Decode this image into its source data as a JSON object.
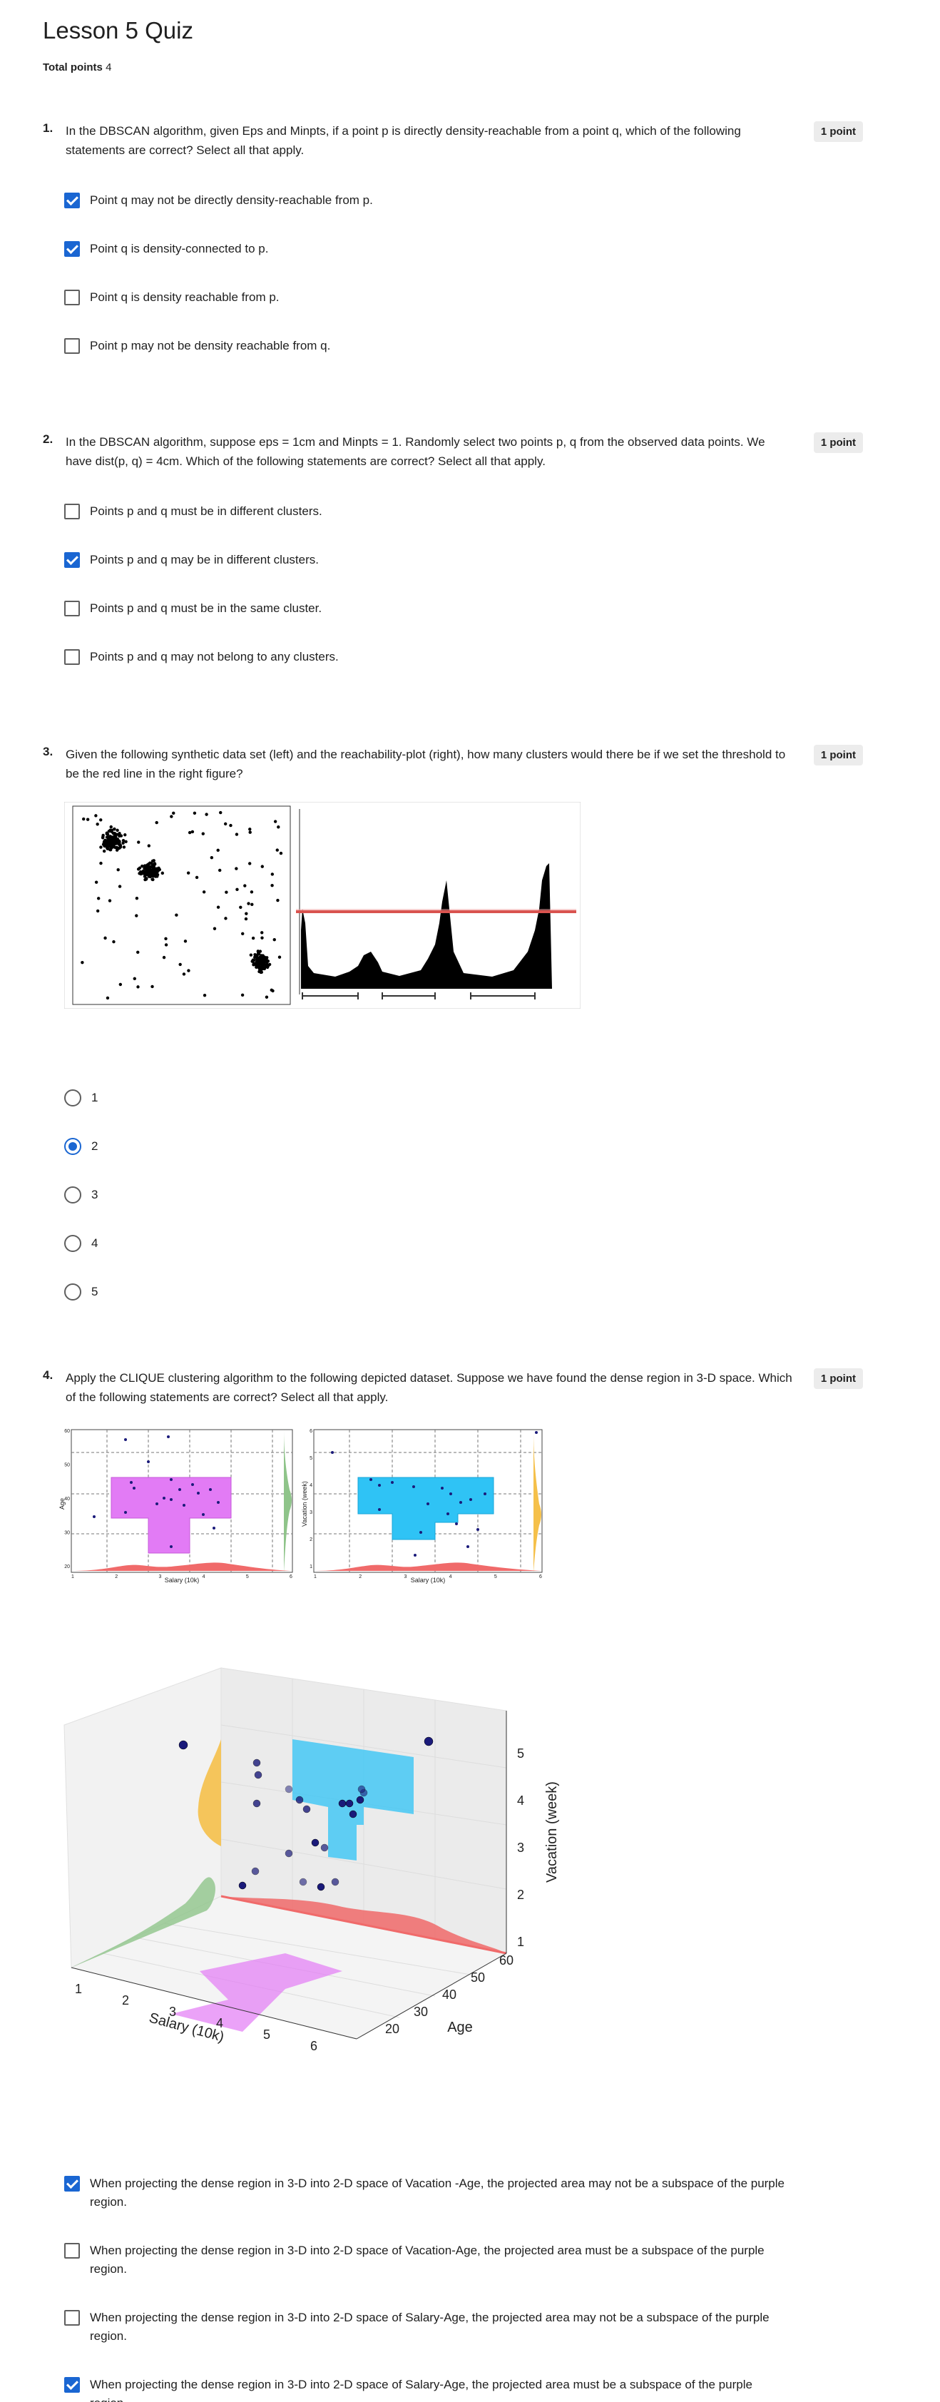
{
  "page": {
    "title": "Lesson 5 Quiz",
    "total_points_label": "Total points",
    "total_points_value": "4"
  },
  "questions": [
    {
      "number": "1.",
      "text": "In the DBSCAN algorithm, given Eps and Minpts, if a point p is directly density-reachable from a point q, which of the following statements are correct? Select all that apply.",
      "points": "1 point",
      "options": [
        {
          "label": "Point q may not be directly density-reachable from p.",
          "checked": true
        },
        {
          "label": "Point q is density-connected to p.",
          "checked": true
        },
        {
          "label": "Point q is density reachable from p.",
          "checked": false
        },
        {
          "label": "Point p may not be density reachable from q.",
          "checked": false
        }
      ]
    },
    {
      "number": "2.",
      "text": "In the DBSCAN algorithm, suppose eps = 1cm and Minpts = 1. Randomly select two points p, q from the observed data points. We have dist(p, q) = 4cm. Which of the following statements are correct? Select all that apply.",
      "points": "1 point",
      "options": [
        {
          "label": "Points p and q must be in different clusters.",
          "checked": false
        },
        {
          "label": "Points p and q may be in different clusters.",
          "checked": true
        },
        {
          "label": "Points p and q must be in the same cluster.",
          "checked": false
        },
        {
          "label": "Points p and q may not belong to any clusters.",
          "checked": false
        }
      ]
    },
    {
      "number": "3.",
      "text": "Given the following synthetic data set (left) and the reachability-plot (right), how many clusters would there be if we set the threshold to be the red line in the right figure?",
      "points": "1 point",
      "options": [
        {
          "label": "1",
          "checked": false
        },
        {
          "label": "2",
          "checked": true
        },
        {
          "label": "3",
          "checked": false
        },
        {
          "label": "4",
          "checked": false
        },
        {
          "label": "5",
          "checked": false
        }
      ]
    },
    {
      "number": "4.",
      "text": "Apply the CLIQUE clustering algorithm to the following depicted dataset. Suppose we have found the dense region in 3-D space. Which of the following statements are correct? Select all that apply.",
      "points": "1 point",
      "options": [
        {
          "label": "When projecting the dense region in 3-D into 2-D space of Vacation -Age, the projected area may not be a subspace of the purple region.",
          "checked": true
        },
        {
          "label": "When projecting the dense region in 3-D into 2-D space of Vacation-Age, the projected area must be a subspace of the purple region.",
          "checked": false
        },
        {
          "label": "When projecting the dense region in 3-D into 2-D space of Salary-Age, the projected area may not be a subspace of the purple region.",
          "checked": false
        },
        {
          "label": "When projecting the dense region in 3-D into 2-D space of Salary-Age, the projected area must be a subspace of the purple region.",
          "checked": true
        }
      ]
    }
  ],
  "figure_q4": {
    "left_plot": {
      "xlabel": "Salary (10k)",
      "ylabel": "Age",
      "x_ticks": [
        "1",
        "2",
        "3",
        "4",
        "5",
        "6"
      ],
      "y_ticks": [
        "20",
        "30",
        "40",
        "50",
        "60"
      ]
    },
    "right_plot": {
      "xlabel": "Salary (10k)",
      "ylabel": "Vacation (week)",
      "x_ticks": [
        "1",
        "2",
        "3",
        "4",
        "5",
        "6"
      ],
      "y_ticks": [
        "1",
        "2",
        "3",
        "4",
        "5",
        "6"
      ]
    },
    "plot3d": {
      "xlabel": "Salary (10k)",
      "ylabel": "Age",
      "zlabel": "Vacation (week)",
      "x_ticks": [
        "1",
        "2",
        "3",
        "4",
        "5",
        "6"
      ],
      "y_ticks": [
        "20",
        "30",
        "40",
        "50",
        "60"
      ],
      "z_ticks": [
        "1",
        "2",
        "3",
        "4",
        "5"
      ]
    },
    "colors": {
      "purple": "#e27bf5",
      "cyan": "#2fc3f5",
      "point": "#1a1a7a",
      "red": "#f06a6a",
      "green": "#8fc48a",
      "yellow": "#f5c04a"
    }
  }
}
